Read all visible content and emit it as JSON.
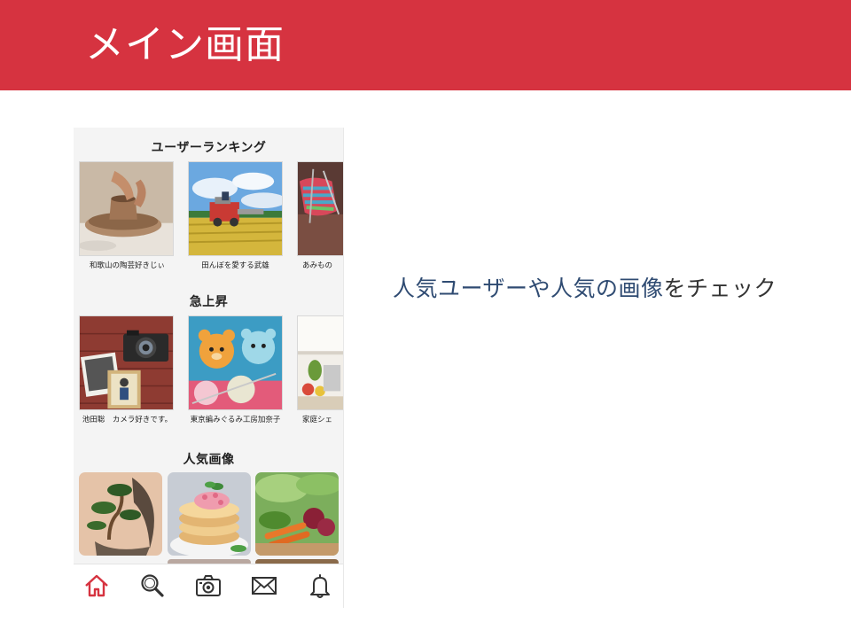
{
  "slide": {
    "title": "メイン画面",
    "caption_part1": "人気ユーザーや人気の画像",
    "caption_part2": "をチェック"
  },
  "app": {
    "sections": {
      "ranking_title": "ユーザーランキング",
      "rising_title": "急上昇",
      "popular_title": "人気画像"
    },
    "ranking_users": [
      {
        "name": "和歌山の陶芸好きじぃ",
        "image": "pottery-wheel"
      },
      {
        "name": "田んぼを愛する武雄",
        "image": "rice-harvester"
      },
      {
        "name": "あみもの",
        "image": "knitting"
      }
    ],
    "rising_users": [
      {
        "name": "池田聡　カメラ好きです。",
        "image": "vintage-camera"
      },
      {
        "name": "東京編みぐるみ工房加奈子",
        "image": "knitted-bears"
      },
      {
        "name": "家庭シェ",
        "image": "kitchen"
      }
    ],
    "popular_images": [
      "bonsai",
      "pancakes",
      "vegetables"
    ],
    "tabs": [
      {
        "name": "home",
        "icon": "home-icon",
        "active": true
      },
      {
        "name": "search",
        "icon": "search-icon",
        "active": false
      },
      {
        "name": "camera",
        "icon": "camera-icon",
        "active": false
      },
      {
        "name": "messages",
        "icon": "mail-icon",
        "active": false
      },
      {
        "name": "notifications",
        "icon": "bell-icon",
        "active": false
      }
    ]
  },
  "colors": {
    "header_red": "#d63340",
    "caption_blue": "#2f4b72",
    "active_tab": "#d63340",
    "inactive_tab": "#333333"
  }
}
